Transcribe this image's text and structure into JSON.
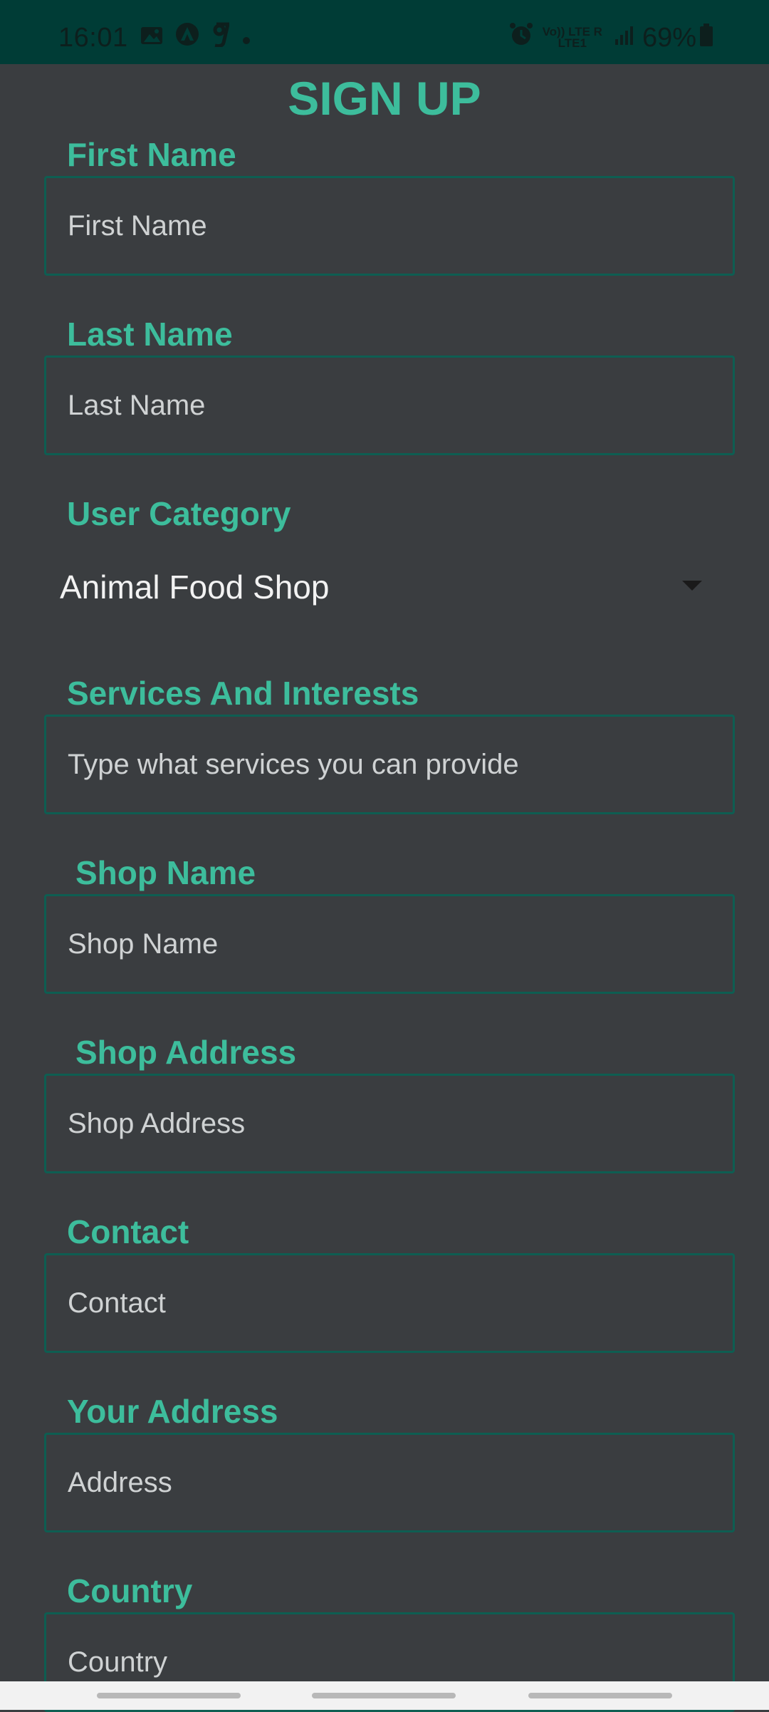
{
  "status_bar": {
    "time": "16:01",
    "battery": "69%",
    "network_top": "Vo)) LTE R",
    "network_bottom": "LTE1",
    "icons": [
      "image-icon",
      "app-a-icon",
      "g-icon",
      "dot-icon",
      "alarm-icon",
      "signal-icon",
      "battery-icon"
    ]
  },
  "title": "SIGN UP",
  "form": {
    "first_name": {
      "label": "First Name",
      "placeholder": "First Name"
    },
    "last_name": {
      "label": "Last Name",
      "placeholder": "Last Name"
    },
    "user_category": {
      "label": "User Category",
      "value": "Animal Food Shop"
    },
    "services": {
      "label": "Services And Interests",
      "placeholder": "Type what services you can provide"
    },
    "shop_name": {
      "label": "Shop Name",
      "placeholder": "Shop Name"
    },
    "shop_address": {
      "label": "Shop Address",
      "placeholder": "Shop Address"
    },
    "contact": {
      "label": "Contact",
      "placeholder": "Contact"
    },
    "your_address": {
      "label": "Your Address",
      "placeholder": "Address"
    },
    "country": {
      "label": "Country",
      "placeholder": "Country"
    }
  },
  "colors": {
    "accent": "#3dbd9c",
    "background": "#3a3d40",
    "status_bar": "#003c36",
    "field_border": "#0e5e52"
  }
}
